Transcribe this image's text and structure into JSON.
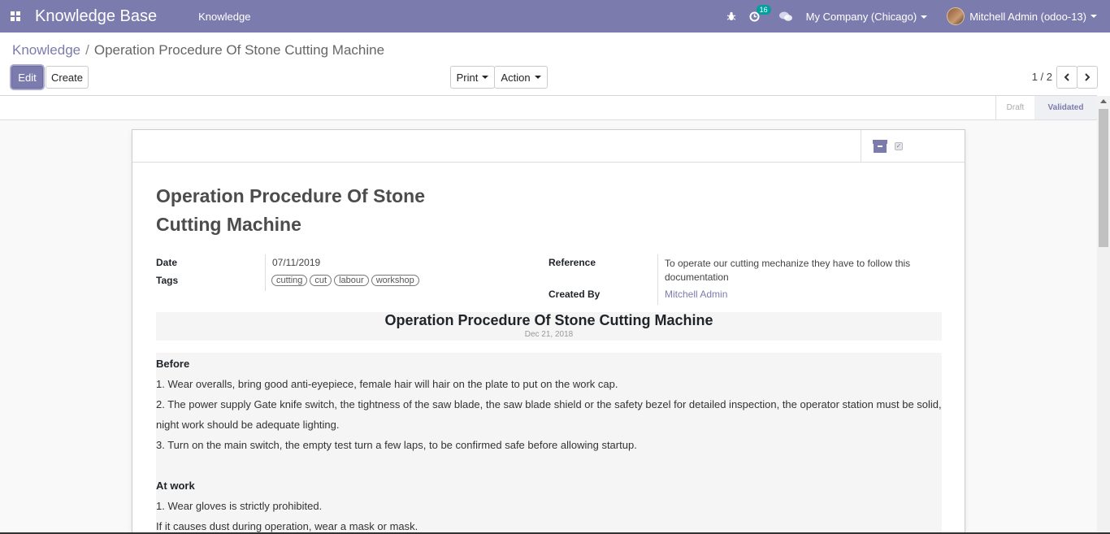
{
  "navbar": {
    "app_title": "Knowledge Base",
    "menu_item": "Knowledge",
    "activity_count": "16",
    "company": "My Company (Chicago)",
    "user": "Mitchell Admin (odoo-13)"
  },
  "breadcrumb": {
    "parent": "Knowledge",
    "separator": "/",
    "current": "Operation Procedure Of Stone Cutting Machine"
  },
  "toolbar": {
    "edit_label": "Edit",
    "create_label": "Create",
    "print_label": "Print",
    "action_label": "Action"
  },
  "pager": {
    "value": "1 / 2"
  },
  "statusbar": {
    "stages": [
      "Draft",
      "Validated"
    ],
    "active": "Validated"
  },
  "record": {
    "title_line1": "Operation Procedure Of Stone",
    "title_line2": "Cutting Machine",
    "date_label": "Date",
    "date_value": "07/11/2019",
    "tags_label": "Tags",
    "tags": [
      "cutting",
      "cut",
      "labour",
      "workshop"
    ],
    "reference_label": "Reference",
    "reference_value_line1": "To operate our cutting mechanize they have to follow this",
    "reference_value_line2": "documentation",
    "created_by_label": "Created By",
    "created_by_value": "Mitchell Admin"
  },
  "content": {
    "title": "Operation Procedure Of Stone Cutting Machine",
    "date": "Dec 21, 2018",
    "before_heading": "Before",
    "before_1": "1. Wear overalls, bring good anti-eyepiece, female hair will hair on the plate to put on the work cap.",
    "before_2a": "2. The power supply Gate knife switch, the tightness of the saw blade, the saw blade shield or the safety bezel for detailed inspection, the operator station must be solid,",
    "before_2b": "night work should be adequate lighting.",
    "before_3": "3. Turn on the main switch, the empty test turn a few laps, to be confirmed safe before allowing startup.",
    "atwork_heading": "At work",
    "atwork_1": "1. Wear gloves is strictly prohibited.",
    "atwork_2": "If it causes dust during operation, wear a mask or mask."
  },
  "colors": {
    "brand": "#7c7bad",
    "badge": "#00a09d"
  }
}
